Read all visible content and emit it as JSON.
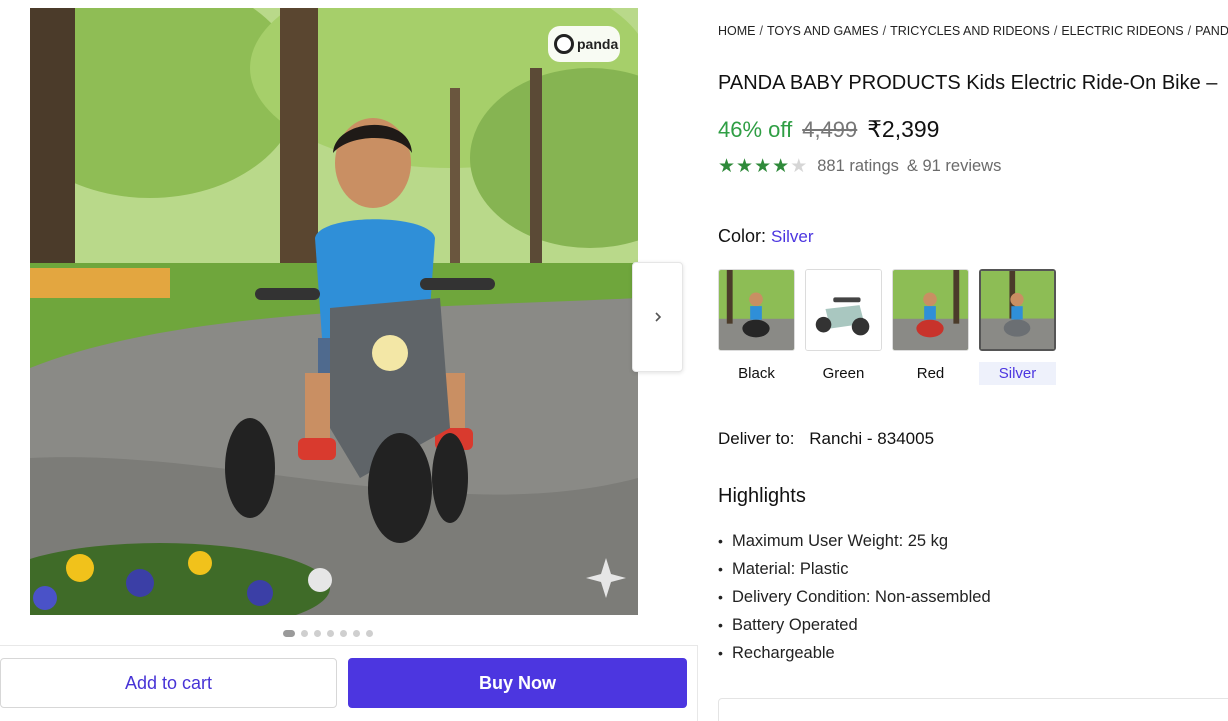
{
  "breadcrumb": [
    "HOME",
    "TOYS AND GAMES",
    "TRICYCLES AND RIDEONS",
    "ELECTRIC RIDEONS",
    "PANDA"
  ],
  "breadcrumb_separator": "/",
  "product": {
    "title": "PANDA BABY PRODUCTS Kids Electric Ride-On Bike –",
    "discount": "46% off",
    "mrp": "4,499",
    "price": "₹2,399",
    "rating_value": 4,
    "rating_max": 5,
    "ratings_text": "881 ratings",
    "reviews_text": "& 91 reviews"
  },
  "gallery": {
    "brand_badge": "panda",
    "slide_count": 7,
    "active_slide": 1
  },
  "color": {
    "label": "Color:",
    "selected": "Silver",
    "options": [
      "Black",
      "Green",
      "Red",
      "Silver"
    ]
  },
  "delivery": {
    "label": "Deliver to:",
    "location": "Ranchi - 834005"
  },
  "highlights": {
    "title": "Highlights",
    "items": [
      "Maximum User Weight: 25 kg",
      "Material: Plastic",
      "Delivery Condition: Non-assembled",
      "Battery Operated",
      "Rechargeable"
    ]
  },
  "actions": {
    "add_to_cart": "Add to cart",
    "buy_now": "Buy Now"
  },
  "colors": {
    "accent": "#4c36e0",
    "discount_green": "#2f9e44",
    "star_green": "#2f8a3a"
  }
}
